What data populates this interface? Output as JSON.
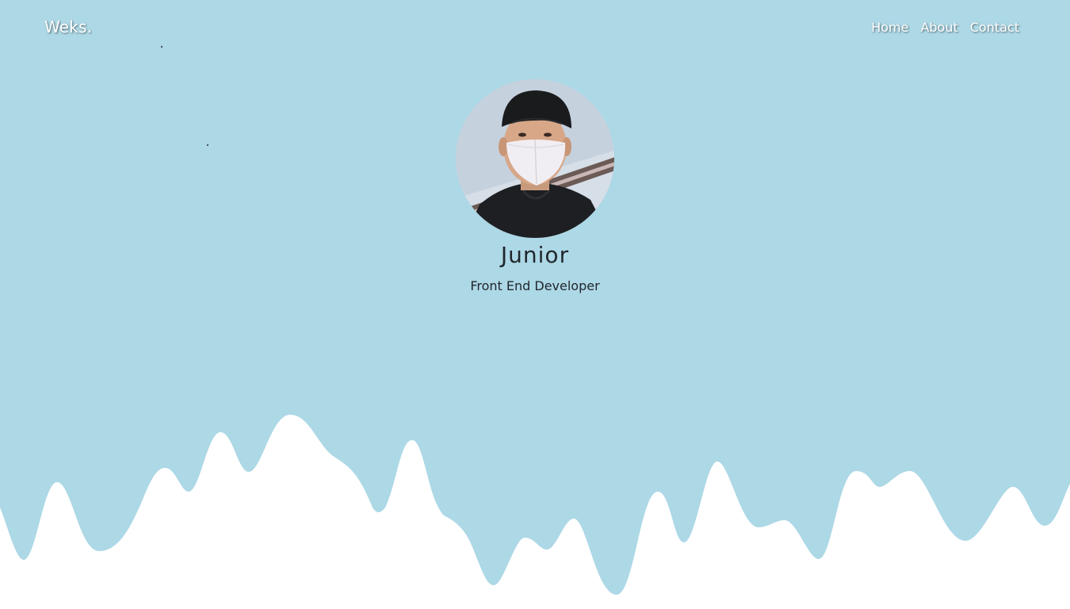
{
  "brand": {
    "logo": "Weks."
  },
  "nav": {
    "items": [
      {
        "label": "Home"
      },
      {
        "label": "About"
      },
      {
        "label": "Contact"
      }
    ]
  },
  "profile": {
    "avatar_icon": "profile-photo",
    "name": "Junior",
    "role": "Front End Developer"
  },
  "colors": {
    "background": "#add8e6",
    "wave": "#ffffff",
    "text": "#22272d"
  }
}
